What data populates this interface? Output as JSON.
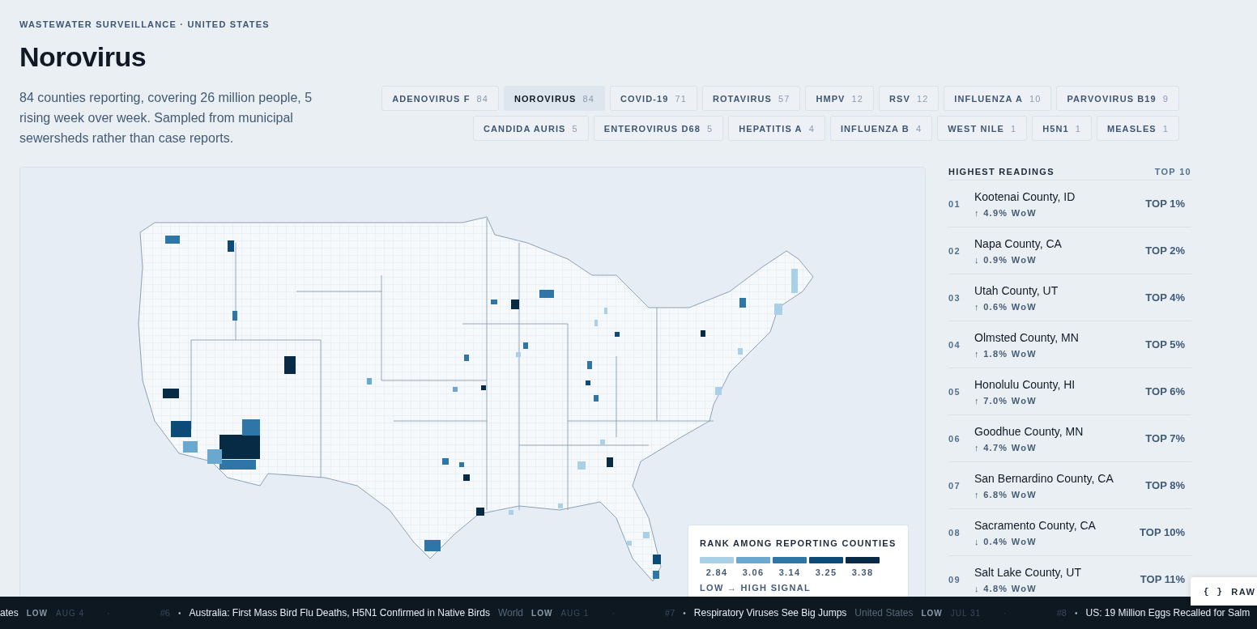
{
  "header": {
    "eyebrow": "WASTEWATER SURVEILLANCE · UNITED STATES",
    "title": "Norovirus",
    "summary": "84 counties reporting, covering 26 million people, 5 rising week over week. Sampled from municipal sewersheds rather than case reports."
  },
  "pathogens": [
    {
      "label": "ADENOVIRUS F",
      "count": "84",
      "selected": false
    },
    {
      "label": "NOROVIRUS",
      "count": "84",
      "selected": true
    },
    {
      "label": "COVID-19",
      "count": "71",
      "selected": false
    },
    {
      "label": "ROTAVIRUS",
      "count": "57",
      "selected": false
    },
    {
      "label": "HMPV",
      "count": "12",
      "selected": false
    },
    {
      "label": "RSV",
      "count": "12",
      "selected": false
    },
    {
      "label": "INFLUENZA A",
      "count": "10",
      "selected": false
    },
    {
      "label": "PARVOVIRUS B19",
      "count": "9",
      "selected": false
    },
    {
      "label": "CANDIDA AURIS",
      "count": "5",
      "selected": false
    },
    {
      "label": "ENTEROVIRUS D68",
      "count": "5",
      "selected": false
    },
    {
      "label": "HEPATITIS A",
      "count": "4",
      "selected": false
    },
    {
      "label": "INFLUENZA B",
      "count": "4",
      "selected": false
    },
    {
      "label": "WEST NILE",
      "count": "1",
      "selected": false
    },
    {
      "label": "H5N1",
      "count": "1",
      "selected": false
    },
    {
      "label": "MEASLES",
      "count": "1",
      "selected": false
    }
  ],
  "legend": {
    "title": "RANK AMONG REPORTING COUNTIES",
    "bins": [
      {
        "label": "2.84",
        "color": "#a9d0e6"
      },
      {
        "label": "3.06",
        "color": "#6aa8cf"
      },
      {
        "label": "3.14",
        "color": "#2e75a8"
      },
      {
        "label": "3.25",
        "color": "#0c4a78"
      },
      {
        "label": "3.38",
        "color": "#082b45"
      }
    ],
    "caption": "LOW → HIGH SIGNAL"
  },
  "readings": {
    "title": "HIGHEST READINGS",
    "scope": "TOP 10",
    "rows": [
      {
        "rank": "01",
        "county": "Kootenai County, ID",
        "change": "↑ 4.9% WoW",
        "percentile": "TOP 1%"
      },
      {
        "rank": "02",
        "county": "Napa County, CA",
        "change": "↓ 0.9% WoW",
        "percentile": "TOP 2%"
      },
      {
        "rank": "03",
        "county": "Utah County, UT",
        "change": "↑ 0.6% WoW",
        "percentile": "TOP 4%"
      },
      {
        "rank": "04",
        "county": "Olmsted County, MN",
        "change": "↑ 1.8% WoW",
        "percentile": "TOP 5%"
      },
      {
        "rank": "05",
        "county": "Honolulu County, HI",
        "change": "↑ 7.0% WoW",
        "percentile": "TOP 6%"
      },
      {
        "rank": "06",
        "county": "Goodhue County, MN",
        "change": "↑ 4.7% WoW",
        "percentile": "TOP 7%"
      },
      {
        "rank": "07",
        "county": "San Bernardino County, CA",
        "change": "↑ 6.8% WoW",
        "percentile": "TOP 8%"
      },
      {
        "rank": "08",
        "county": "Sacramento County, CA",
        "change": "↓ 0.4% WoW",
        "percentile": "TOP 10%"
      },
      {
        "rank": "09",
        "county": "Salt Lake County, UT",
        "change": "↓ 4.8% WoW",
        "percentile": "TOP 11%"
      }
    ]
  },
  "ticker": [
    {
      "headline": "ates",
      "level": "LOW",
      "date": "AUG 4",
      "sep": "·"
    },
    {
      "number": "#6",
      "bullet": "•",
      "headline": "Australia: First Mass Bird Flu Deaths, H5N1 Confirmed in Native Birds",
      "region": "World",
      "level": "LOW",
      "date": "AUG 1",
      "sep": "·"
    },
    {
      "number": "#7",
      "bullet": "•",
      "headline": "Respiratory Viruses See Big Jumps",
      "region": "United States",
      "level": "LOW",
      "date": "JUL 31",
      "sep": "·"
    },
    {
      "number": "#8",
      "bullet": "•",
      "headline": "US: 19 Million Eggs Recalled for Salm"
    }
  ],
  "raw_button": {
    "icon": "{ }",
    "label": "RAW"
  }
}
